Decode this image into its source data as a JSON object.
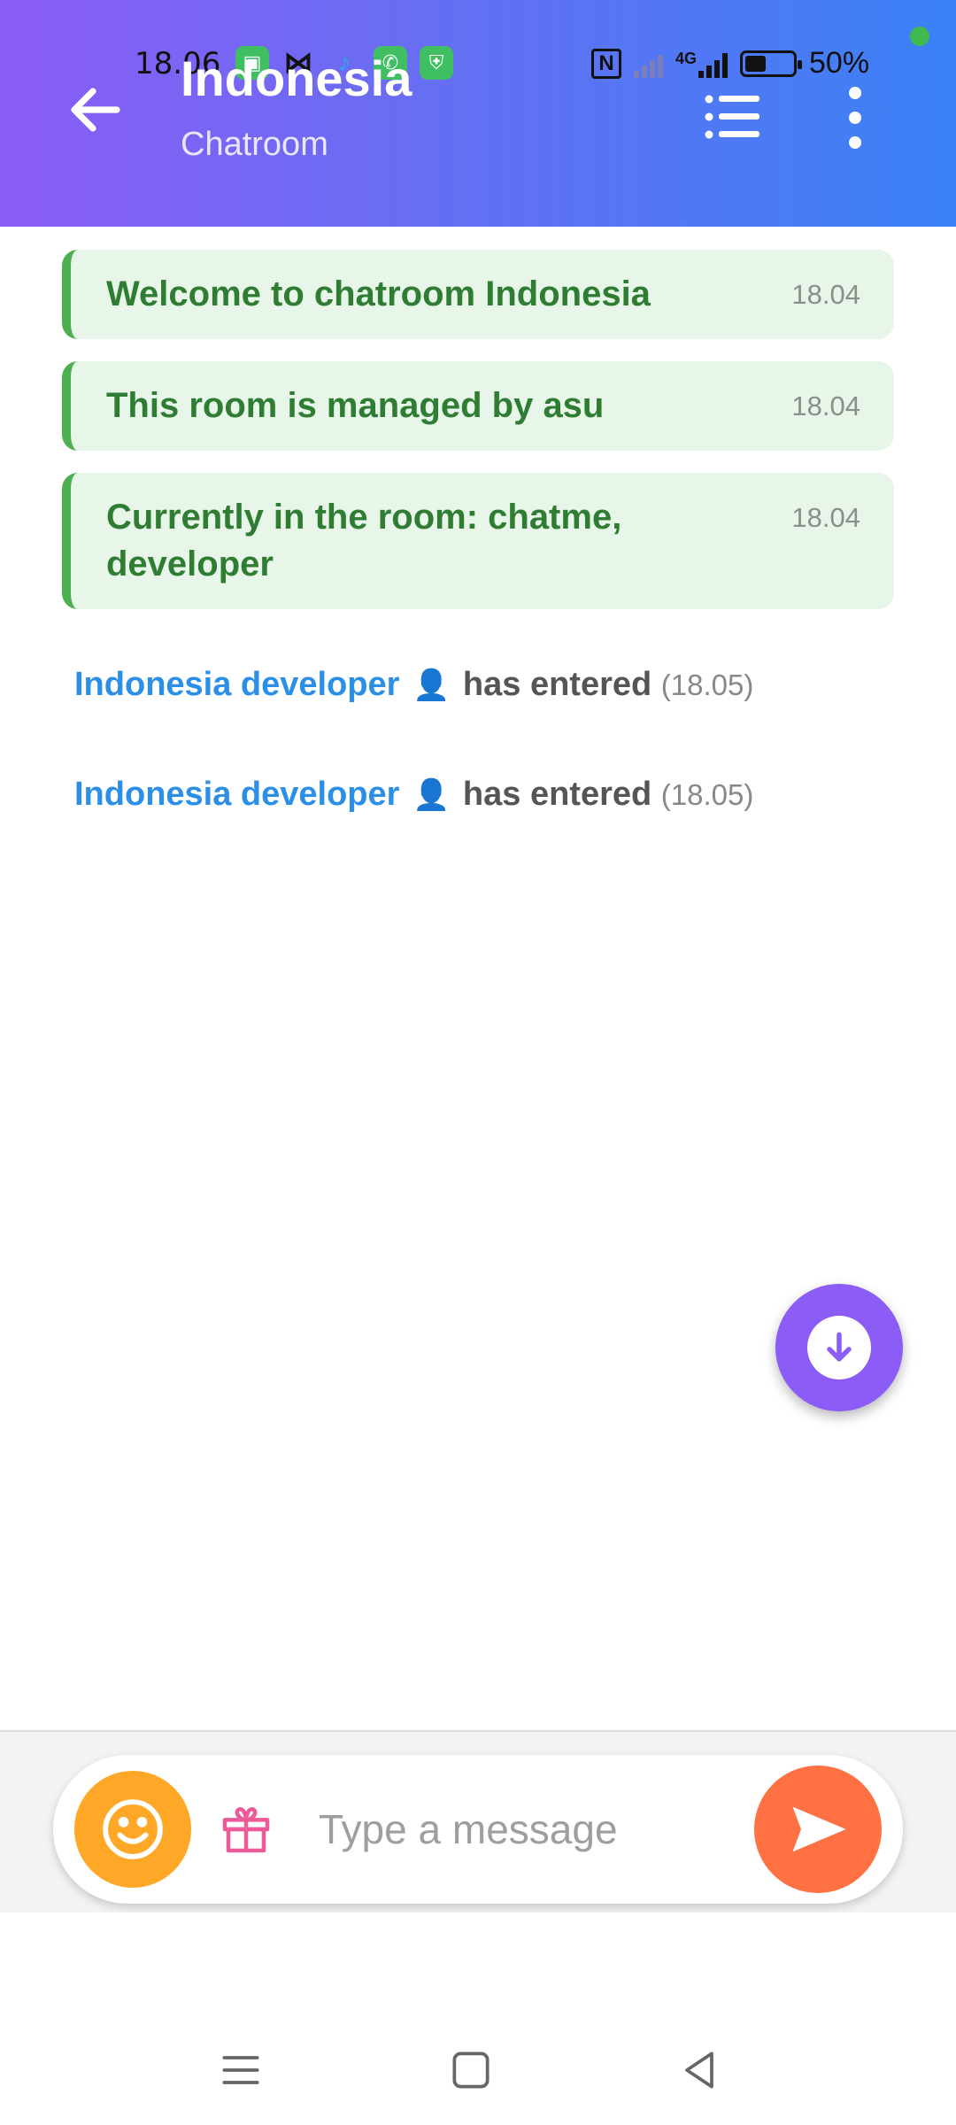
{
  "status_bar": {
    "time": "18.06",
    "battery_pct": "50%",
    "battery_level": 0.5,
    "network_label": "4G",
    "icons": [
      "shop-icon",
      "capcut-icon",
      "tiktok-icon",
      "phone-icon",
      "shield-icon",
      "nfc-icon",
      "signal-icon",
      "signal-4g-icon",
      "battery-icon"
    ]
  },
  "header": {
    "title": "Indonesia",
    "subtitle": "Chatroom",
    "back_icon": "arrow-left-icon",
    "list_icon": "list-icon",
    "more_icon": "more-vertical-icon",
    "gradient": [
      "#8b5cf6",
      "#3b82f6"
    ]
  },
  "messages": {
    "system": [
      {
        "text": "Welcome to chatroom Indonesia",
        "time": "18.04"
      },
      {
        "text": "This room is managed by asu",
        "time": "18.04"
      },
      {
        "text": "Currently in the room: chatme, developer",
        "time": "18.04"
      }
    ],
    "events": [
      {
        "user": "Indonesia developer",
        "person_icon": "👤",
        "action": "has entered",
        "time": "(18.05)"
      },
      {
        "user": "Indonesia developer",
        "person_icon": "👤",
        "action": "has entered",
        "time": "(18.05)"
      }
    ]
  },
  "input": {
    "placeholder": "Type a message",
    "value": "",
    "emoji_icon": "smile-icon",
    "gift_icon": "gift-icon",
    "send_icon": "send-icon"
  },
  "colors": {
    "system_bg": "#e8f5e9",
    "system_text": "#2e7d32",
    "user_link": "#2b8fe8",
    "fab": "#8b5cf6",
    "emoji_btn": "#ffa726",
    "send_btn": "#ff7043"
  }
}
